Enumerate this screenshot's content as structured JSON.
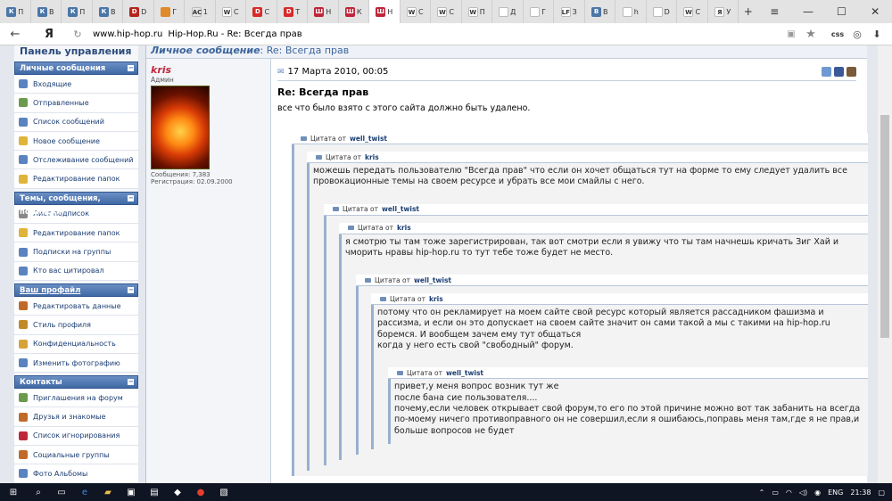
{
  "tabs": [
    {
      "icon": "vk-icon",
      "letter": "К",
      "label": "П",
      "color": "#4a76a8"
    },
    {
      "icon": "vk-icon",
      "letter": "К",
      "label": "В",
      "color": "#4a76a8"
    },
    {
      "icon": "vk-icon",
      "letter": "К",
      "label": "П",
      "color": "#4a76a8"
    },
    {
      "icon": "vk-icon",
      "letter": "К",
      "label": "В",
      "color": "#4a76a8"
    },
    {
      "icon": "dota-icon",
      "letter": "D",
      "label": "D",
      "color": "#b3261e"
    },
    {
      "icon": "site-icon",
      "letter": "",
      "label": "Г",
      "color": "#e08a2c"
    },
    {
      "icon": "ac-icon",
      "letter": "AC",
      "label": "1",
      "color": "#e7e7e7"
    },
    {
      "icon": "wiki-icon",
      "letter": "W",
      "label": "С",
      "color": "#fff"
    },
    {
      "icon": "d-icon",
      "letter": "D",
      "label": "С",
      "color": "#d62b2b"
    },
    {
      "icon": "d-icon",
      "letter": "D",
      "label": "Т",
      "color": "#d62b2b"
    },
    {
      "icon": "hiphop-icon",
      "letter": "Ш",
      "label": "Н",
      "color": "#c0263b"
    },
    {
      "icon": "hiphop-icon",
      "letter": "Ш",
      "label": "К",
      "color": "#c0263b"
    },
    {
      "icon": "hiphop-icon",
      "letter": "Ш",
      "label": "Н",
      "color": "#c0263b",
      "active": true
    },
    {
      "icon": "wiki-icon",
      "letter": "W",
      "label": "С",
      "color": "#fff"
    },
    {
      "icon": "wiki-icon",
      "letter": "W",
      "label": "С",
      "color": "#fff"
    },
    {
      "icon": "wiki-icon",
      "letter": "W",
      "label": "П",
      "color": "#fff"
    },
    {
      "icon": "loading-icon",
      "letter": "",
      "label": "Д",
      "color": "#fff"
    },
    {
      "icon": "hand-icon",
      "letter": "",
      "label": "Г",
      "color": "#fff"
    },
    {
      "icon": "lf-icon",
      "letter": "LF",
      "label": "З",
      "color": "#fff"
    },
    {
      "icon": "docs-icon",
      "letter": "B",
      "label": "В",
      "color": "#4a76a8"
    },
    {
      "icon": "horse-icon",
      "letter": "",
      "label": "h",
      "color": "#fff"
    },
    {
      "icon": "loading-icon",
      "letter": "",
      "label": "D",
      "color": "#fff"
    },
    {
      "icon": "wiki-icon",
      "letter": "W",
      "label": "С",
      "color": "#fff"
    },
    {
      "icon": "yandex-icon",
      "letter": "Я",
      "label": "У",
      "color": "#fff"
    }
  ],
  "window": {
    "new_tab": "+",
    "menu": "≡",
    "minimize": "—",
    "maximize": "☐",
    "close": "✕"
  },
  "address": {
    "back": "←",
    "yandex": "Я",
    "url": "www.hip-hop.ru",
    "title": "Hip-Hop.Ru - Re: Всегда прав",
    "css": "css"
  },
  "sidebar": {
    "title": "Панель управления",
    "sections": [
      {
        "title": "Личные сообщения",
        "items": [
          {
            "label": "Входящие",
            "icon": "inbox-icon",
            "color": "#5b83c0"
          },
          {
            "label": "Отправленные",
            "icon": "sent-icon",
            "color": "#6b9a4c"
          },
          {
            "label": "Список сообщений",
            "icon": "list-icon",
            "color": "#5b83c0"
          },
          {
            "label": "Новое сообщение",
            "icon": "new-message-icon",
            "color": "#e0b33a"
          },
          {
            "label": "Отслеживание сообщений",
            "icon": "tracking-icon",
            "color": "#5b83c0"
          },
          {
            "label": "Редактирование папок",
            "icon": "folder-icon",
            "color": "#e0b33a"
          }
        ]
      },
      {
        "title": "Темы, сообщения, подписки",
        "items": [
          {
            "label": "Лист подписок",
            "icon": "subscriptions-icon",
            "color": "#888"
          },
          {
            "label": "Редактирование папок",
            "icon": "folder-icon",
            "color": "#e0b33a"
          },
          {
            "label": "Подписки на группы",
            "icon": "group-icon",
            "color": "#5b83c0"
          },
          {
            "label": "Кто вас цитировал",
            "icon": "quote-icon",
            "color": "#5b83c0"
          }
        ]
      },
      {
        "title": "Ваш профайл",
        "items": [
          {
            "label": "Редактировать данные",
            "icon": "edit-icon",
            "color": "#c06a2a"
          },
          {
            "label": "Стиль профиля",
            "icon": "style-icon",
            "color": "#c08a2a"
          },
          {
            "label": "Конфиденциальность",
            "icon": "privacy-icon",
            "color": "#d6a33a"
          },
          {
            "label": "Изменить фотографию",
            "icon": "photo-icon",
            "color": "#5b83c0"
          }
        ]
      },
      {
        "title": "Контакты",
        "items": [
          {
            "label": "Приглашения на форум",
            "icon": "invite-icon",
            "color": "#6b9a4c"
          },
          {
            "label": "Друзья и знакомые",
            "icon": "friends-icon",
            "color": "#c06a2a"
          },
          {
            "label": "Список игнорирования",
            "icon": "ignore-icon",
            "color": "#c0263b"
          },
          {
            "label": "Социальные группы",
            "icon": "groups-icon",
            "color": "#c06a2a"
          },
          {
            "label": "Фото Альбомы",
            "icon": "albums-icon",
            "color": "#5b83c0"
          }
        ]
      }
    ]
  },
  "breadcrumb": {
    "section": "Личное сообщение",
    "sep": ":",
    "title": "Re: Всегда прав"
  },
  "user": {
    "name": "kris",
    "role": "Админ",
    "messages": "Сообщения: 7,383",
    "registered": "Регистрация: 02.09.2000"
  },
  "post": {
    "date": "17 Марта 2010, 00:05",
    "title": "Re: Всегда прав",
    "text": "все что было взято с этого сайта должно быть удалено.",
    "quote_prefix": "Цитата от",
    "q1_author": "well_twist",
    "q2_author": "kris",
    "q2_text": "можешь передать пользователю \"Всегда прав\" что если он хочет общаться тут на форме то ему следует удалить все провокационные темы на своем ресурсе и убрать все мои смайлы с него.",
    "q3_author": "well_twist",
    "q4_author": "kris",
    "q4_text": "я смотрю ты там тоже зарегистрирован, так вот смотри если я увижу что ты там начнешь кричать Зиг Хай и чморить нравы hip-hop.ru то тут тебе тоже будет не место.",
    "q5_author": "well_twist",
    "q6_author": "kris",
    "q6_line1": "потому что он рекламирует на моем сайте свой ресурс который является рассадником фашизма и рассизма, и если он это допускает на своем сайте значит он сами такой а мы с такими на hip-hop.ru боремся. И вообщем зачем ему тут общаться",
    "q6_line2": "когда у него есть свой \"свободный\" форум.",
    "q7_author": "well_twist",
    "q7_l1": "привет,у меня вопрос возник тут же",
    "q7_l2": "после бана сие пользователя....",
    "q7_l3": "почему,если человек открывает свой форум,то его по этой причине можно вот так забанить на всегда",
    "q7_l4": "по-моему ничего противоправного он не совершил,если я ошибаюсь,поправь меня там,где я не прав,и больше вопросов не будет"
  },
  "taskbar": {
    "lang": "ENG",
    "time": "21:38"
  }
}
